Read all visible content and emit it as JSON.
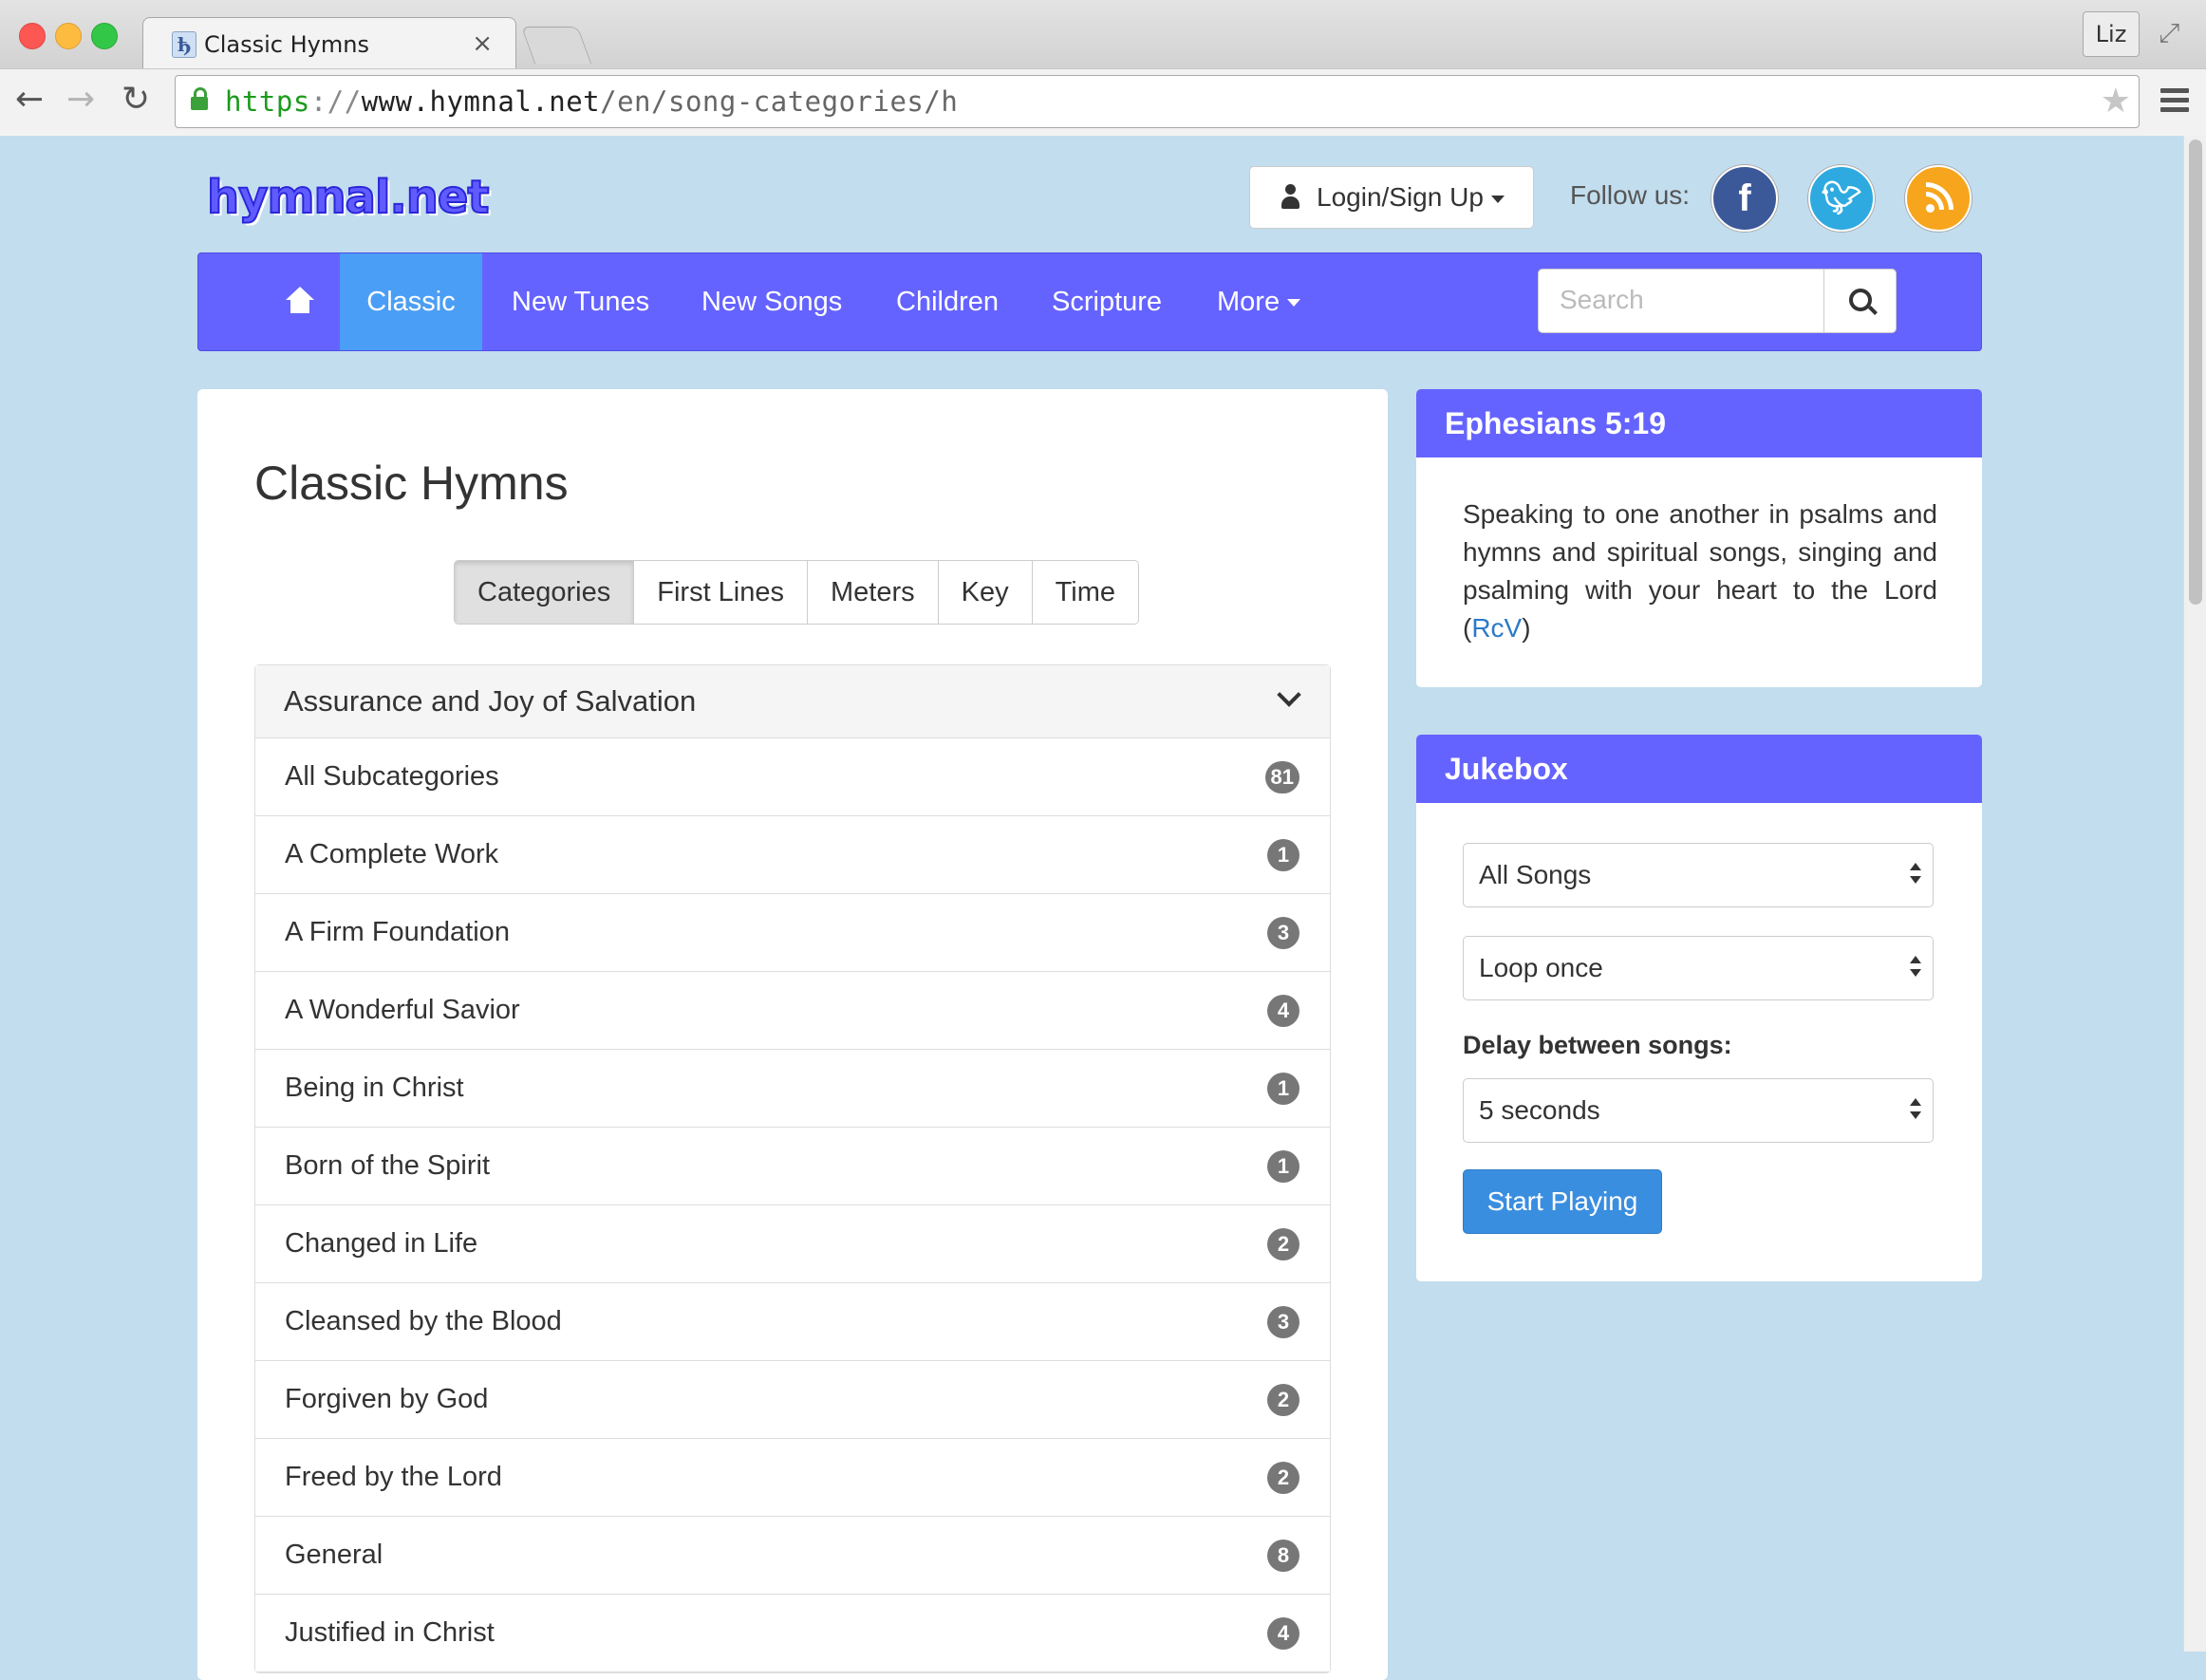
{
  "browser": {
    "tab_title": "Classic Hymns",
    "tab_favicon": "ђ",
    "tab_close": "×",
    "profile": "Liz",
    "url": {
      "scheme": "https",
      "sep": "://",
      "host": "www.hymnal.net",
      "path": "/en/song-categories/h"
    }
  },
  "header": {
    "logo": "hymnal.net",
    "login_label": "Login/Sign Up",
    "follow_label": "Follow us:",
    "social": {
      "facebook": "f",
      "twitter": "t"
    }
  },
  "nav": {
    "items": [
      {
        "label": "Classic",
        "active": true
      },
      {
        "label": "New Tunes"
      },
      {
        "label": "New Songs"
      },
      {
        "label": "Children"
      },
      {
        "label": "Scripture"
      },
      {
        "label": "More"
      }
    ],
    "search_placeholder": "Search"
  },
  "main": {
    "title": "Classic Hymns",
    "view_tabs": [
      "Categories",
      "First Lines",
      "Meters",
      "Key",
      "Time"
    ],
    "active_view": "Categories",
    "category": {
      "title": "Assurance and Joy of Salvation",
      "subcategories": [
        {
          "label": "All Subcategories",
          "count": "81"
        },
        {
          "label": "A Complete Work",
          "count": "1"
        },
        {
          "label": "A Firm Foundation",
          "count": "3"
        },
        {
          "label": "A Wonderful Savior",
          "count": "4"
        },
        {
          "label": "Being in Christ",
          "count": "1"
        },
        {
          "label": "Born of the Spirit",
          "count": "1"
        },
        {
          "label": "Changed in Life",
          "count": "2"
        },
        {
          "label": "Cleansed by the Blood",
          "count": "3"
        },
        {
          "label": "Forgiven by God",
          "count": "2"
        },
        {
          "label": "Freed by the Lord",
          "count": "2"
        },
        {
          "label": "General",
          "count": "8"
        },
        {
          "label": "Justified in Christ",
          "count": "4"
        }
      ]
    }
  },
  "sidebar": {
    "verse": {
      "reference": "Ephesians 5:19",
      "text": "Speaking to one another in psalms and hymns and spiritual songs, singing and psalming with your heart to the Lord",
      "open_paren": "(",
      "version_link": "RcV",
      "close_paren": ")"
    },
    "jukebox": {
      "title": "Jukebox",
      "song_select": "All Songs",
      "loop_select": "Loop once",
      "delay_label": "Delay between songs:",
      "delay_select": "5 seconds",
      "start_button": "Start Playing"
    }
  },
  "colors": {
    "page_bg": "#c2ddee",
    "nav_bg": "#6563ff",
    "nav_active": "#4b9ef5",
    "primary_button": "#3a8ee0",
    "badge": "#777777"
  }
}
